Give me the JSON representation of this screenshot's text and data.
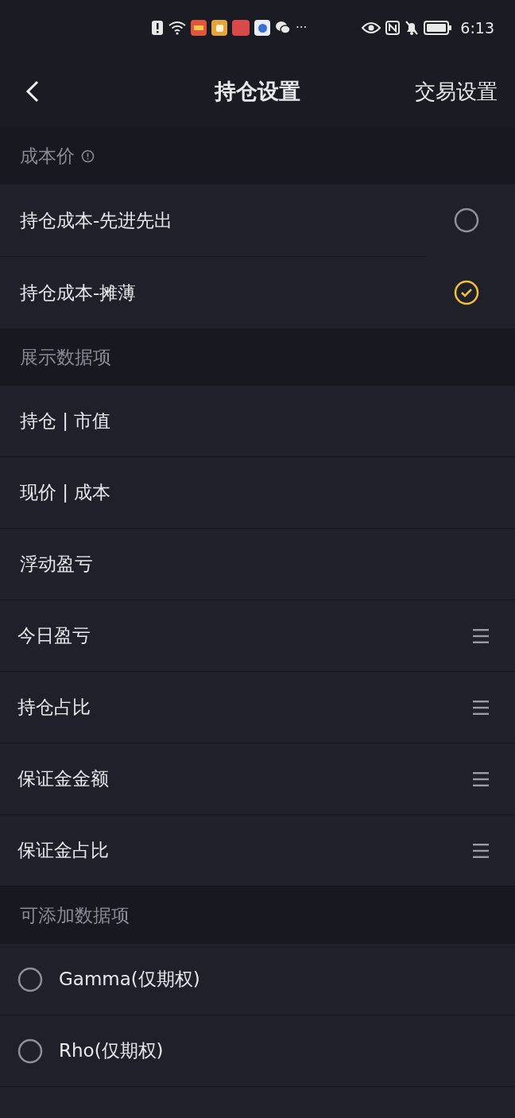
{
  "status_bar": {
    "time": "6:13",
    "more": "···"
  },
  "header": {
    "title": "持仓设置",
    "action": "交易设置"
  },
  "cost_section": {
    "title": "成本价",
    "options": [
      {
        "label": "持仓成本-先进先出",
        "selected": false
      },
      {
        "label": "持仓成本-摊薄",
        "selected": true
      }
    ]
  },
  "display_section": {
    "title": "展示数据项",
    "items": [
      {
        "label": "持仓 | 市值",
        "draggable": false
      },
      {
        "label": "现价 | 成本",
        "draggable": false
      },
      {
        "label": "浮动盈亏",
        "draggable": false
      },
      {
        "label": "今日盈亏",
        "draggable": true
      },
      {
        "label": "持仓占比",
        "draggable": true
      },
      {
        "label": "保证金金额",
        "draggable": true
      },
      {
        "label": "保证金占比",
        "draggable": true
      }
    ]
  },
  "addable_section": {
    "title": "可添加数据项",
    "items": [
      {
        "label": "Gamma(仅期权)",
        "checked": false
      },
      {
        "label": "Rho(仅期权)",
        "checked": false
      }
    ]
  }
}
